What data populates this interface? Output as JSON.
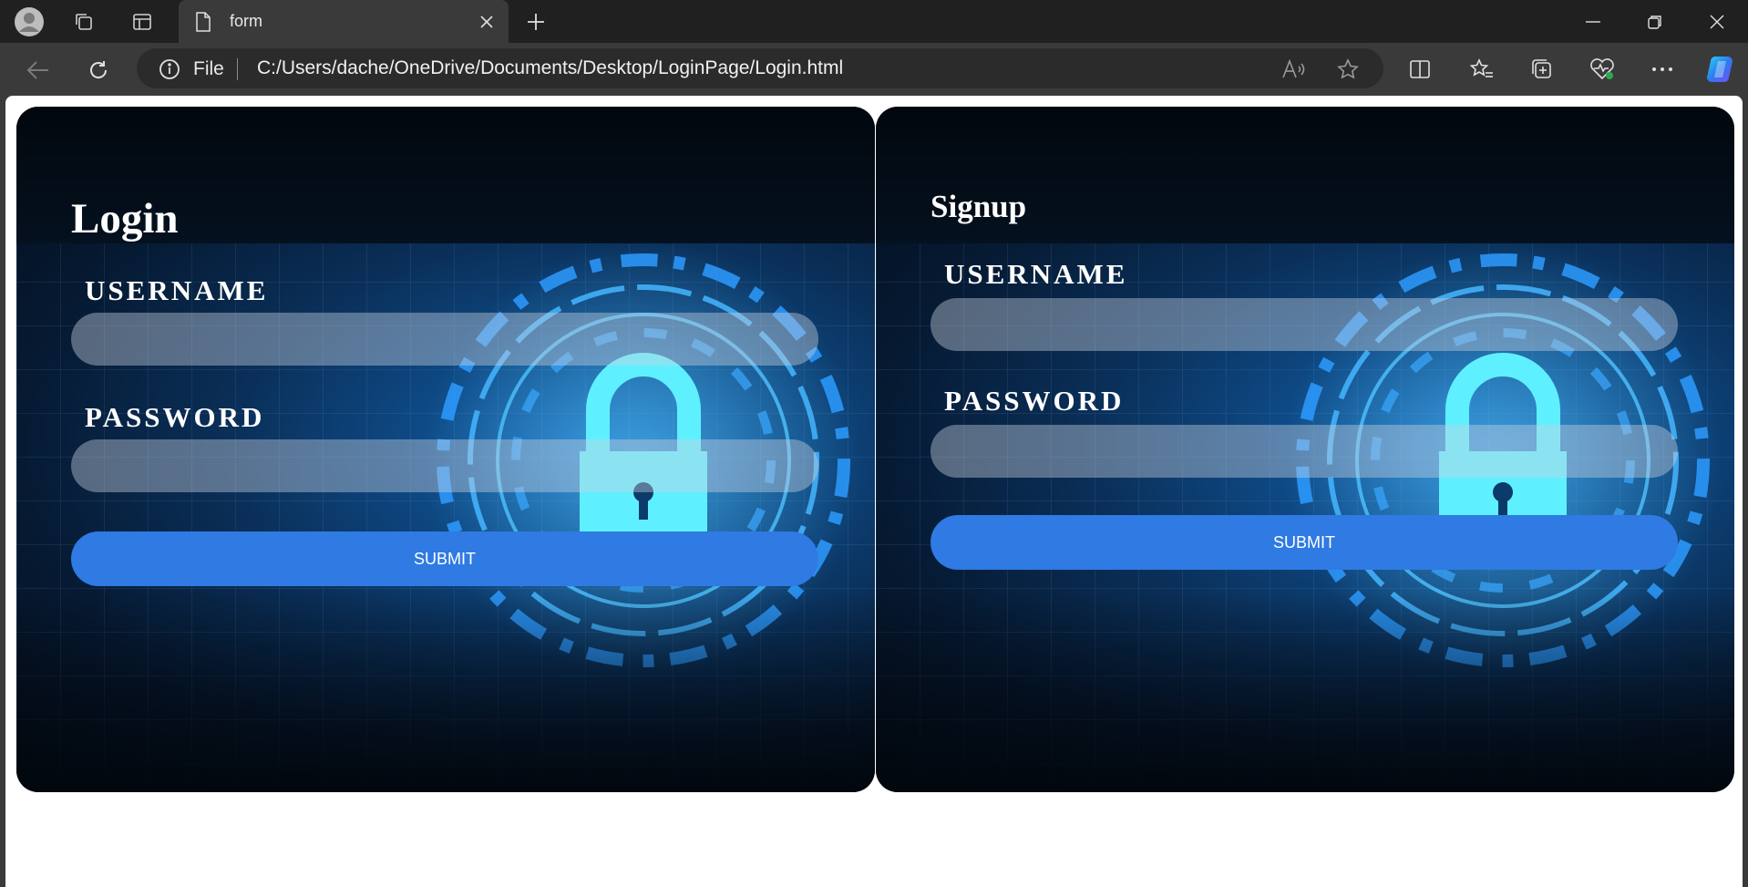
{
  "browser": {
    "tab": {
      "title": "form"
    },
    "address": {
      "scheme_label": "File",
      "url": "C:/Users/dache/OneDrive/Documents/Desktop/LoginPage/Login.html"
    }
  },
  "login": {
    "title": "Login",
    "username_label": "USERNAME",
    "password_label": "PASSWORD",
    "submit_label": "SUBMIT",
    "username_value": "",
    "password_value": ""
  },
  "signup": {
    "title": "Signup",
    "username_label": "USERNAME",
    "password_label": "PASSWORD",
    "submit_label": "SUBMIT",
    "username_value": "",
    "password_value": ""
  },
  "colors": {
    "accent": "#2f7ae3",
    "panel_dark": "#030c18",
    "panel_glow": "#1b6bb8",
    "lock": "#5ff0ff"
  },
  "icons": [
    "profile-icon",
    "workspaces-icon",
    "tab-actions-icon",
    "document-icon",
    "close-icon",
    "plus-icon",
    "minimize-icon",
    "restore-icon",
    "window-close-icon",
    "back-icon",
    "refresh-icon",
    "info-icon",
    "read-aloud-icon",
    "favorite-star-icon",
    "split-screen-icon",
    "favorites-icon",
    "collections-icon",
    "browser-essentials-icon",
    "more-icon",
    "copilot-icon",
    "padlock-icon"
  ]
}
